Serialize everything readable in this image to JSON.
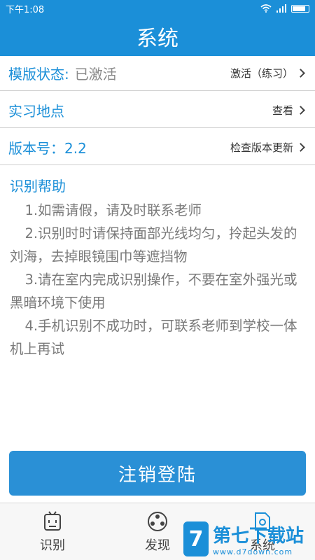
{
  "status_bar": {
    "time": "下午1:08",
    "wifi_icon": "wifi-icon",
    "signal_icon": "signal-icon",
    "battery_icon": "battery-icon"
  },
  "header": {
    "title": "系统"
  },
  "rows": {
    "template_status": {
      "label": "模版状态:",
      "value": "已激活",
      "action": "激活（练习）"
    },
    "location": {
      "label": "实习地点",
      "action": "查看"
    },
    "version": {
      "label": "版本号：2.2",
      "action": "检查版本更新"
    }
  },
  "help": {
    "title": "识别帮助",
    "items": [
      "1.如需请假，请及时联系老师",
      "2.识别时时请保持面部光线均匀，拎起头发的刘海，去掉眼镜围巾等遮挡物",
      "3.请在室内完成识别操作，不要在室外强光或黑暗环境下使用",
      "4.手机识别不成功时，可联系老师到学校一体机上再试"
    ]
  },
  "logout_button": "注销登陆",
  "tabs": [
    {
      "label": "识别",
      "icon": "recognize-icon"
    },
    {
      "label": "发现",
      "icon": "discover-icon"
    },
    {
      "label": "系统",
      "icon": "system-icon"
    }
  ],
  "watermark": {
    "logo": "7",
    "cn": "第七下载站",
    "en": "www.d7down.com"
  },
  "colors": {
    "primary": "#1b8fd8",
    "button": "#2a90d6",
    "text_gray": "#7a7a7a"
  }
}
